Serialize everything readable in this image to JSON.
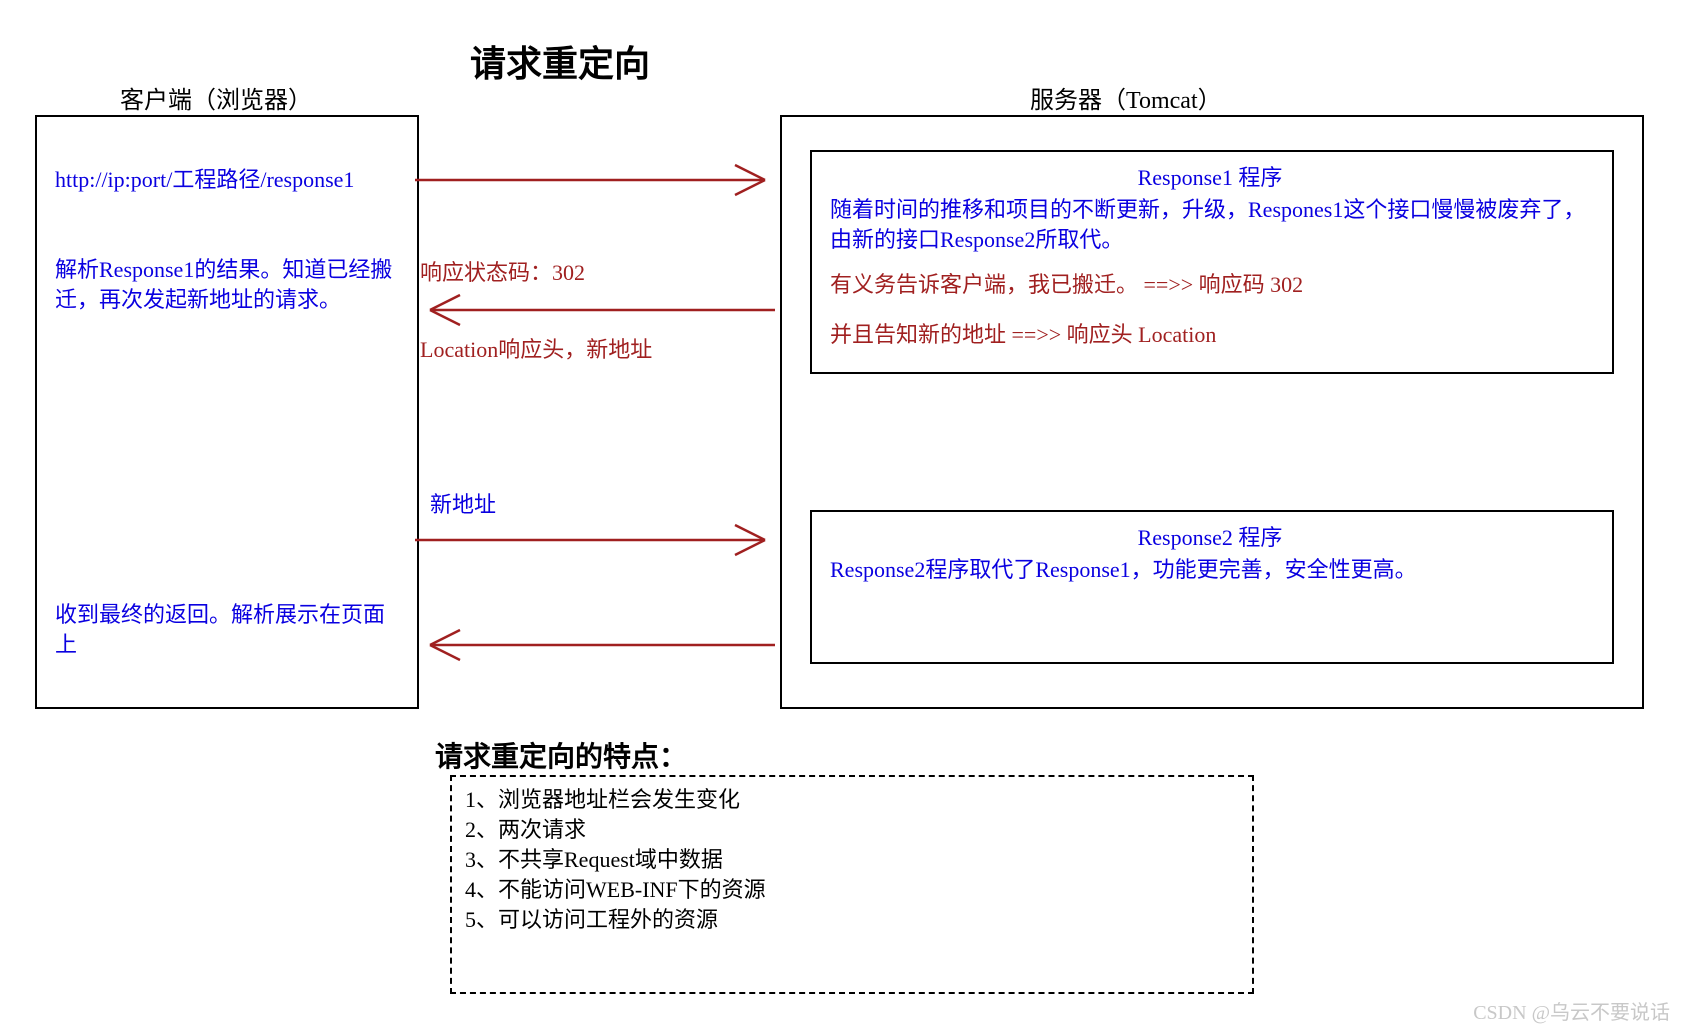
{
  "title": "请求重定向",
  "client_label": "客户端（浏览器）",
  "server_label": "服务器（Tomcat）",
  "request1_url": "http://ip:port/工程路径/response1",
  "client_parse": "解析Response1的结果。知道已经搬迁，再次发起新地址的请求。",
  "client_final": "收到最终的返回。解析展示在页面上",
  "arrow1_status": "响应状态码：302",
  "arrow1_location": "Location响应头，新地址",
  "arrow2_label": "新地址",
  "resp1_title": "Response1 程序",
  "resp1_line1": "随着时间的推移和项目的不断更新，升级，Respones1这个接口慢慢被废弃了，由新的接口Response2所取代。",
  "resp1_line2": "有义务告诉客户端，我已搬迁。 ==>> 响应码 302",
  "resp1_line3": "并且告知新的地址   ==>> 响应头 Location",
  "resp2_title": "Response2 程序",
  "resp2_line1": "Response2程序取代了Response1，功能更完善，安全性更高。",
  "features_title": "请求重定向的特点：",
  "feature1": "1、浏览器地址栏会发生变化",
  "feature2": "2、两次请求",
  "feature3": "3、不共享Request域中数据",
  "feature4": "4、不能访问WEB-INF下的资源",
  "feature5": "5、可以访问工程外的资源",
  "watermark": "CSDN @乌云不要说话"
}
